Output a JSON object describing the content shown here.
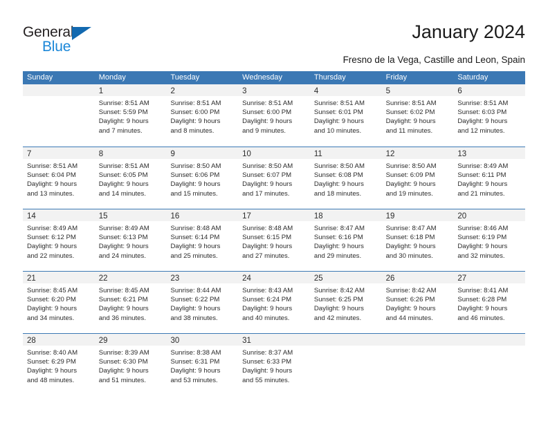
{
  "brand": {
    "name_top": "General",
    "name_bottom": "Blue",
    "triangle_color": "#1269b0",
    "blue_text_color": "#1b87d8"
  },
  "header": {
    "title": "January 2024",
    "subtitle": "Fresno de la Vega, Castille and Leon, Spain"
  },
  "theme": {
    "header_blue": "#3b78b4",
    "daynum_band": "#f2f2f2",
    "text": "#2b2b2b"
  },
  "weekdays": [
    "Sunday",
    "Monday",
    "Tuesday",
    "Wednesday",
    "Thursday",
    "Friday",
    "Saturday"
  ],
  "weeks": [
    [
      {
        "day": "",
        "lines": []
      },
      {
        "day": "1",
        "lines": [
          "Sunrise: 8:51 AM",
          "Sunset: 5:59 PM",
          "Daylight: 9 hours",
          "and 7 minutes."
        ]
      },
      {
        "day": "2",
        "lines": [
          "Sunrise: 8:51 AM",
          "Sunset: 6:00 PM",
          "Daylight: 9 hours",
          "and 8 minutes."
        ]
      },
      {
        "day": "3",
        "lines": [
          "Sunrise: 8:51 AM",
          "Sunset: 6:00 PM",
          "Daylight: 9 hours",
          "and 9 minutes."
        ]
      },
      {
        "day": "4",
        "lines": [
          "Sunrise: 8:51 AM",
          "Sunset: 6:01 PM",
          "Daylight: 9 hours",
          "and 10 minutes."
        ]
      },
      {
        "day": "5",
        "lines": [
          "Sunrise: 8:51 AM",
          "Sunset: 6:02 PM",
          "Daylight: 9 hours",
          "and 11 minutes."
        ]
      },
      {
        "day": "6",
        "lines": [
          "Sunrise: 8:51 AM",
          "Sunset: 6:03 PM",
          "Daylight: 9 hours",
          "and 12 minutes."
        ]
      }
    ],
    [
      {
        "day": "7",
        "lines": [
          "Sunrise: 8:51 AM",
          "Sunset: 6:04 PM",
          "Daylight: 9 hours",
          "and 13 minutes."
        ]
      },
      {
        "day": "8",
        "lines": [
          "Sunrise: 8:51 AM",
          "Sunset: 6:05 PM",
          "Daylight: 9 hours",
          "and 14 minutes."
        ]
      },
      {
        "day": "9",
        "lines": [
          "Sunrise: 8:50 AM",
          "Sunset: 6:06 PM",
          "Daylight: 9 hours",
          "and 15 minutes."
        ]
      },
      {
        "day": "10",
        "lines": [
          "Sunrise: 8:50 AM",
          "Sunset: 6:07 PM",
          "Daylight: 9 hours",
          "and 17 minutes."
        ]
      },
      {
        "day": "11",
        "lines": [
          "Sunrise: 8:50 AM",
          "Sunset: 6:08 PM",
          "Daylight: 9 hours",
          "and 18 minutes."
        ]
      },
      {
        "day": "12",
        "lines": [
          "Sunrise: 8:50 AM",
          "Sunset: 6:09 PM",
          "Daylight: 9 hours",
          "and 19 minutes."
        ]
      },
      {
        "day": "13",
        "lines": [
          "Sunrise: 8:49 AM",
          "Sunset: 6:11 PM",
          "Daylight: 9 hours",
          "and 21 minutes."
        ]
      }
    ],
    [
      {
        "day": "14",
        "lines": [
          "Sunrise: 8:49 AM",
          "Sunset: 6:12 PM",
          "Daylight: 9 hours",
          "and 22 minutes."
        ]
      },
      {
        "day": "15",
        "lines": [
          "Sunrise: 8:49 AM",
          "Sunset: 6:13 PM",
          "Daylight: 9 hours",
          "and 24 minutes."
        ]
      },
      {
        "day": "16",
        "lines": [
          "Sunrise: 8:48 AM",
          "Sunset: 6:14 PM",
          "Daylight: 9 hours",
          "and 25 minutes."
        ]
      },
      {
        "day": "17",
        "lines": [
          "Sunrise: 8:48 AM",
          "Sunset: 6:15 PM",
          "Daylight: 9 hours",
          "and 27 minutes."
        ]
      },
      {
        "day": "18",
        "lines": [
          "Sunrise: 8:47 AM",
          "Sunset: 6:16 PM",
          "Daylight: 9 hours",
          "and 29 minutes."
        ]
      },
      {
        "day": "19",
        "lines": [
          "Sunrise: 8:47 AM",
          "Sunset: 6:18 PM",
          "Daylight: 9 hours",
          "and 30 minutes."
        ]
      },
      {
        "day": "20",
        "lines": [
          "Sunrise: 8:46 AM",
          "Sunset: 6:19 PM",
          "Daylight: 9 hours",
          "and 32 minutes."
        ]
      }
    ],
    [
      {
        "day": "21",
        "lines": [
          "Sunrise: 8:45 AM",
          "Sunset: 6:20 PM",
          "Daylight: 9 hours",
          "and 34 minutes."
        ]
      },
      {
        "day": "22",
        "lines": [
          "Sunrise: 8:45 AM",
          "Sunset: 6:21 PM",
          "Daylight: 9 hours",
          "and 36 minutes."
        ]
      },
      {
        "day": "23",
        "lines": [
          "Sunrise: 8:44 AM",
          "Sunset: 6:22 PM",
          "Daylight: 9 hours",
          "and 38 minutes."
        ]
      },
      {
        "day": "24",
        "lines": [
          "Sunrise: 8:43 AM",
          "Sunset: 6:24 PM",
          "Daylight: 9 hours",
          "and 40 minutes."
        ]
      },
      {
        "day": "25",
        "lines": [
          "Sunrise: 8:42 AM",
          "Sunset: 6:25 PM",
          "Daylight: 9 hours",
          "and 42 minutes."
        ]
      },
      {
        "day": "26",
        "lines": [
          "Sunrise: 8:42 AM",
          "Sunset: 6:26 PM",
          "Daylight: 9 hours",
          "and 44 minutes."
        ]
      },
      {
        "day": "27",
        "lines": [
          "Sunrise: 8:41 AM",
          "Sunset: 6:28 PM",
          "Daylight: 9 hours",
          "and 46 minutes."
        ]
      }
    ],
    [
      {
        "day": "28",
        "lines": [
          "Sunrise: 8:40 AM",
          "Sunset: 6:29 PM",
          "Daylight: 9 hours",
          "and 48 minutes."
        ]
      },
      {
        "day": "29",
        "lines": [
          "Sunrise: 8:39 AM",
          "Sunset: 6:30 PM",
          "Daylight: 9 hours",
          "and 51 minutes."
        ]
      },
      {
        "day": "30",
        "lines": [
          "Sunrise: 8:38 AM",
          "Sunset: 6:31 PM",
          "Daylight: 9 hours",
          "and 53 minutes."
        ]
      },
      {
        "day": "31",
        "lines": [
          "Sunrise: 8:37 AM",
          "Sunset: 6:33 PM",
          "Daylight: 9 hours",
          "and 55 minutes."
        ]
      },
      {
        "day": "",
        "lines": []
      },
      {
        "day": "",
        "lines": []
      },
      {
        "day": "",
        "lines": []
      }
    ]
  ]
}
